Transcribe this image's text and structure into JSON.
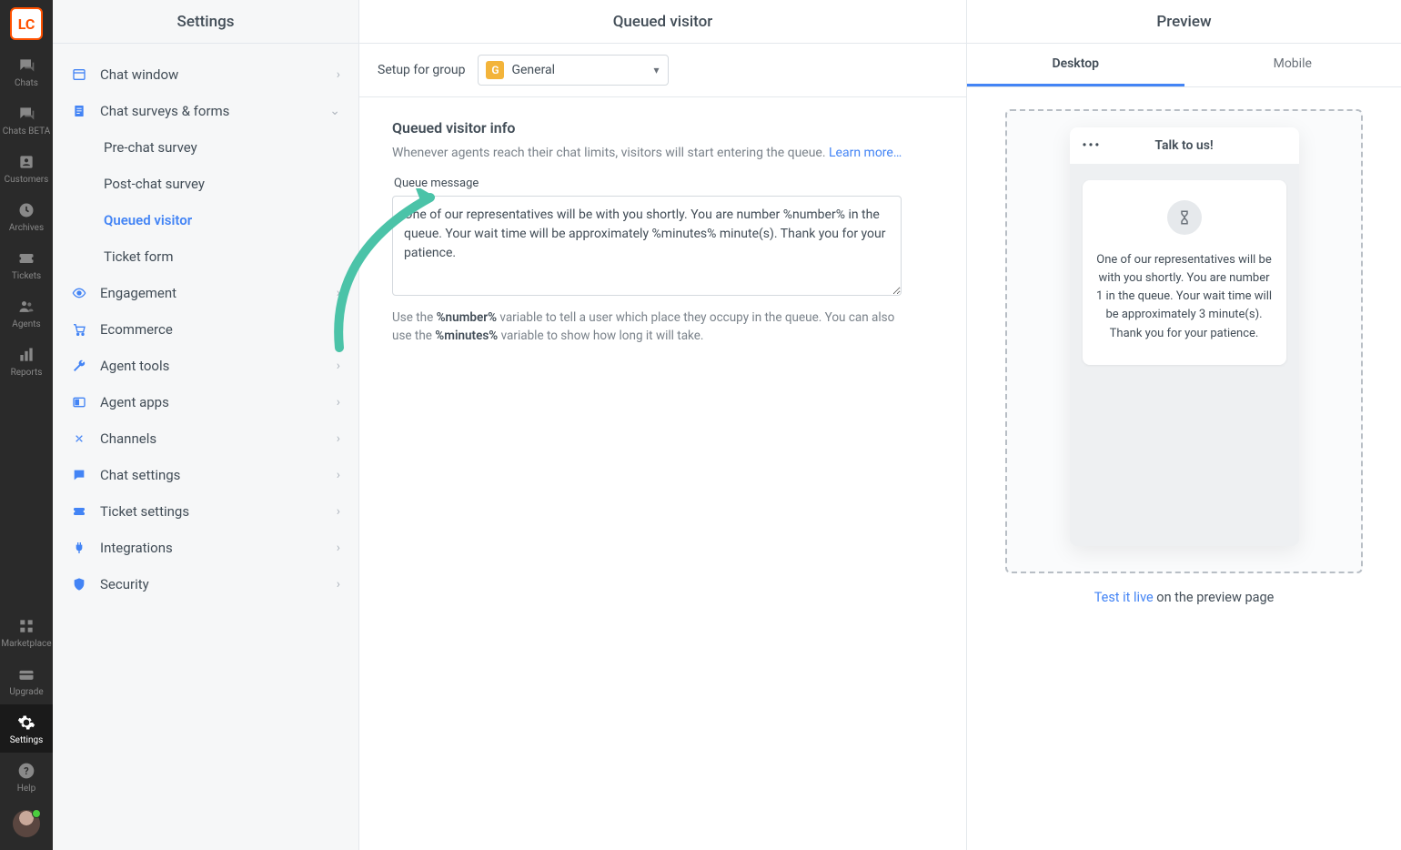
{
  "rail": {
    "items": [
      {
        "label": "Chats"
      },
      {
        "label": "Chats BETA"
      },
      {
        "label": "Customers"
      },
      {
        "label": "Archives"
      },
      {
        "label": "Tickets"
      },
      {
        "label": "Agents"
      },
      {
        "label": "Reports"
      }
    ],
    "bottom": [
      {
        "label": "Marketplace"
      },
      {
        "label": "Upgrade"
      },
      {
        "label": "Settings"
      },
      {
        "label": "Help"
      }
    ]
  },
  "settings": {
    "title": "Settings",
    "items": [
      {
        "label": "Chat window"
      },
      {
        "label": "Chat surveys & forms"
      },
      {
        "label": "Engagement"
      },
      {
        "label": "Ecommerce"
      },
      {
        "label": "Agent tools"
      },
      {
        "label": "Agent apps"
      },
      {
        "label": "Channels"
      },
      {
        "label": "Chat settings"
      },
      {
        "label": "Ticket settings"
      },
      {
        "label": "Integrations"
      },
      {
        "label": "Security"
      }
    ],
    "subitems": [
      {
        "label": "Pre-chat survey"
      },
      {
        "label": "Post-chat survey"
      },
      {
        "label": "Queued visitor"
      },
      {
        "label": "Ticket form"
      }
    ]
  },
  "main": {
    "title": "Queued visitor",
    "setup_label": "Setup for group",
    "group_badge": "G",
    "group_name": "General",
    "section_title": "Queued visitor info",
    "desc_text": "Whenever agents reach their chat limits, visitors will start entering the queue. ",
    "learn_more": "Learn more…",
    "field_label": "Queue message",
    "textarea_value": "One of our representatives will be with you shortly. You are number %number% in the queue. Your wait time will be approximately %minutes% minute(s). Thank you for your patience.",
    "hint_1": "Use the ",
    "hint_b1": "%number%",
    "hint_2": " variable to tell a user which place they occupy in the queue. You can also use the ",
    "hint_b2": "%minutes%",
    "hint_3": " variable to show how long it will take."
  },
  "preview": {
    "title": "Preview",
    "tabs": {
      "desktop": "Desktop",
      "mobile": "Mobile"
    },
    "widget_title": "Talk to us!",
    "message": "One of our representatives will be with you shortly. You are number 1 in the queue. Your wait time will be approximately 3 minute(s). Thank you for your patience.",
    "foot_link": "Test it live",
    "foot_text": " on the preview page"
  }
}
